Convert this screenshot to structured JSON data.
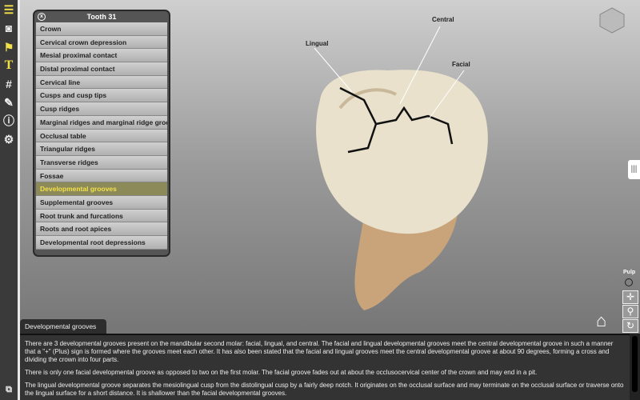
{
  "toolbar": {
    "icons": [
      "list-icon",
      "camera-icon",
      "flag-icon",
      "text-icon",
      "hash-icon",
      "image-edit-icon",
      "info-icon",
      "settings-icon"
    ],
    "accent": "#f2e04a"
  },
  "panel": {
    "title": "Tooth 31",
    "items": [
      "Crown",
      "Cervical crown depression",
      "Mesial proximal contact",
      "Distal proximal contact",
      "Cervical line",
      "Cusps and cusp tips",
      "Cusp ridges",
      "Marginal ridges and marginal ridge grooves",
      "Occlusal table",
      "Triangular ridges",
      "Transverse ridges",
      "Fossae",
      "Developmental grooves",
      "Supplemental grooves",
      "Root trunk and furcations",
      "Roots and root apices",
      "Developmental root depressions"
    ],
    "selected": "Developmental grooves"
  },
  "labels": {
    "lingual": "Lingual",
    "central": "Central",
    "facial": "Facial"
  },
  "pulp": {
    "label": "Pulp"
  },
  "info": {
    "tab": "Developmental grooves",
    "paragraphs": [
      "There are 3 developmental grooves present on the mandibular second molar: facial, lingual, and central.  The facial and lingual developmental grooves meet the central developmental groove in such a manner that a \"+\" (Plus) sign is formed where the grooves meet each other.  It has also been stated that the facial and lingual grooves meet the central developmental groove at about 90 degrees, forming a cross and dividing the crown into four parts.",
      "There is only one facial developmental groove as opposed to two on the first molar.  The facial groove fades out at about the occlusocervical center of the crown and may end in a pit.",
      "The lingual developmental groove separates the mesiolingual cusp from the distolingual cusp by a fairly deep notch.  It originates on the occlusal surface and may terminate on the occlusal surface or traverse onto the lingual surface for a short distance.  It is shallower than the facial developmental grooves."
    ]
  }
}
